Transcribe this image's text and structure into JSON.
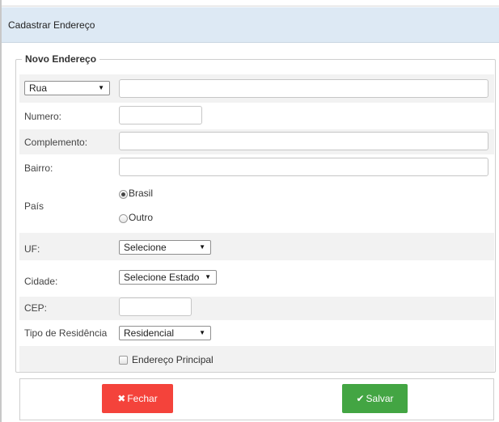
{
  "window": {
    "title": "Cadastrar Endereço"
  },
  "form": {
    "legend": "Novo Endereço",
    "address_type": {
      "selected": "Rua",
      "value": ""
    },
    "numero": {
      "label": "Numero:",
      "value": ""
    },
    "complemento": {
      "label": "Complemento:",
      "value": ""
    },
    "bairro": {
      "label": "Bairro:",
      "value": ""
    },
    "pais": {
      "label": "País",
      "options": [
        "Brasil",
        "Outro"
      ],
      "selected": "Brasil"
    },
    "uf": {
      "label": "UF:",
      "selected": "Selecione"
    },
    "cidade": {
      "label": "Cidade:",
      "selected": "Selecione Estado"
    },
    "cep": {
      "label": "CEP:",
      "value": ""
    },
    "tipo_residencia": {
      "label": "Tipo de Residência",
      "selected": "Residencial"
    },
    "endereco_principal": {
      "label": "Endereço Principal",
      "checked": false
    }
  },
  "footer": {
    "close_label": "Fechar",
    "save_label": "Salvar"
  },
  "icons": {
    "close": "x-icon",
    "save": "checkmark-icon"
  },
  "colors": {
    "title_bar": "#dde9f4",
    "close_button": "#f4433b",
    "save_button": "#43a543",
    "row_shade": "#f2f2f2"
  }
}
